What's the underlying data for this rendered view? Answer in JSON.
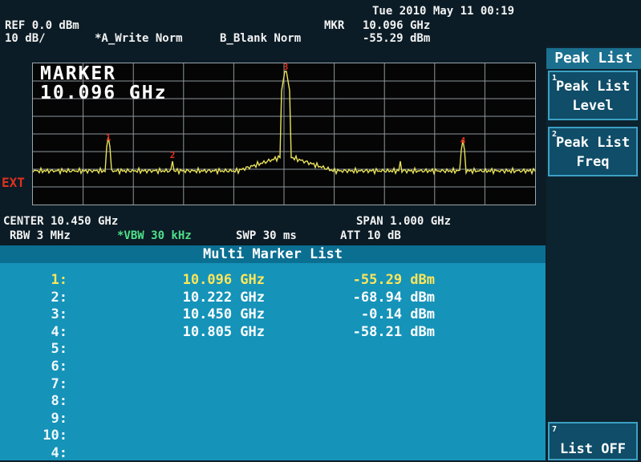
{
  "header": {
    "datetime": "Tue 2010 May 11 00:19",
    "ref": "REF 0.0 dBm",
    "scale": "10 dB/",
    "trace_a": "*A_Write Norm",
    "trace_b": "B_Blank Norm",
    "mkr_label": "MKR",
    "mkr_freq": "10.096 GHz",
    "mkr_amp": "-55.29 dBm"
  },
  "graticule": {
    "marker_title": "MARKER",
    "marker_value": "10.096 GHz",
    "ext_label": "EXT",
    "marker_flags": [
      "1",
      "2",
      "3",
      "4"
    ],
    "trace_color": "#e8e25a",
    "flag_color": "#e0301e"
  },
  "footer": {
    "center": "CENTER 10.450 GHz",
    "span": "SPAN 1.000 GHz",
    "rbw": "RBW 3 MHz",
    "vbw": "*VBW 30 kHz",
    "swp": "SWP 30 ms",
    "att": "ATT 10 dB",
    "vbw_color": "#4fe08a"
  },
  "softkeys": {
    "title": "Peak List",
    "k1_num": "1",
    "k1_line1": "Peak List",
    "k1_line2": "Level",
    "k2_num": "2",
    "k2_line1": "Peak List",
    "k2_line2": "Freq",
    "k7_num": "7",
    "k7_label": "List OFF"
  },
  "marker_list": {
    "title": "Multi Marker List",
    "rows": [
      {
        "idx": "1:",
        "freq": "10.096 GHz",
        "amp": "-55.29 dBm"
      },
      {
        "idx": "2:",
        "freq": "10.222 GHz",
        "amp": "-68.94 dBm"
      },
      {
        "idx": "3:",
        "freq": "10.450 GHz",
        "amp": "-0.14 dBm"
      },
      {
        "idx": "4:",
        "freq": "10.805 GHz",
        "amp": "-58.21 dBm"
      },
      {
        "idx": "5:",
        "freq": "",
        "amp": ""
      },
      {
        "idx": "6:",
        "freq": "",
        "amp": ""
      },
      {
        "idx": "7:",
        "freq": "",
        "amp": ""
      },
      {
        "idx": "8:",
        "freq": "",
        "amp": ""
      },
      {
        "idx": "9:",
        "freq": "",
        "amp": ""
      },
      {
        "idx": "10:",
        "freq": "",
        "amp": ""
      },
      {
        "idx": "4:",
        "freq": "",
        "amp": ""
      }
    ]
  }
}
